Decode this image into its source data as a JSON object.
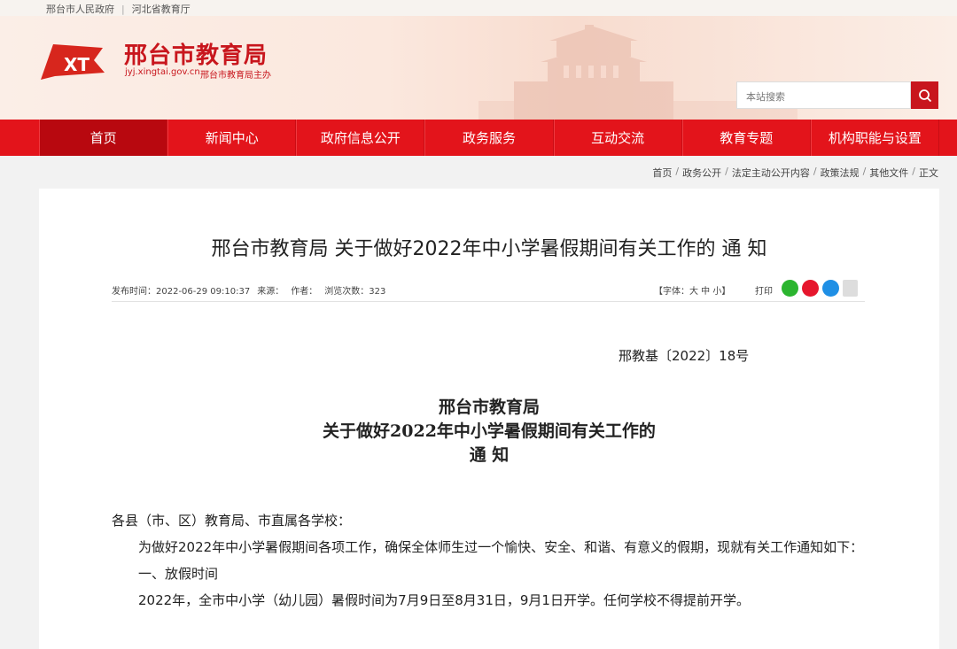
{
  "topbar": {
    "links": [
      "邢台市人民政府",
      "河北省教育厅"
    ]
  },
  "site": {
    "name": "邢台市教育局",
    "url": "jyj.xingtai.gov.cn",
    "sponsor": "邢台市教育局主办",
    "logo_text": "XT"
  },
  "search": {
    "placeholder": "本站搜索"
  },
  "nav": {
    "items": [
      "首页",
      "新闻中心",
      "政府信息公开",
      "政务服务",
      "互动交流",
      "教育专题",
      "机构职能与设置"
    ]
  },
  "breadcrumb": [
    "首页",
    "政务公开",
    "法定主动公开内容",
    "政策法规",
    "其他文件",
    "正文"
  ],
  "article": {
    "title": "邢台市教育局 关于做好2022年中小学暑假期间有关工作的 通 知",
    "publish": "发布时间：2022-06-29 09:10:37",
    "source": "来源：",
    "author": "作者：",
    "views": "浏览次数：323",
    "fontsize": "【字体：大 中 小】",
    "print": "打印",
    "doc_no": "邢教基〔2022〕18号",
    "doc_title_lines": [
      "邢台市教育局",
      "关于做好2022年中小学暑假期间有关工作的",
      "通 知"
    ],
    "salutation": "各县（市、区）教育局、市直属各学校：",
    "para1": "为做好2022年中小学暑假期间各项工作，确保全体师生过一个愉快、安全、和谐、有意义的假期，现就有关工作通知如下：",
    "section1": "一、放假时间",
    "para2": "2022年，全市中小学（幼儿园）暑假时间为7月9日至8月31日，9月1日开学。任何学校不得提前开学。"
  },
  "colors": {
    "brand_red": "#e3141b",
    "nav_active": "#b8080f"
  }
}
